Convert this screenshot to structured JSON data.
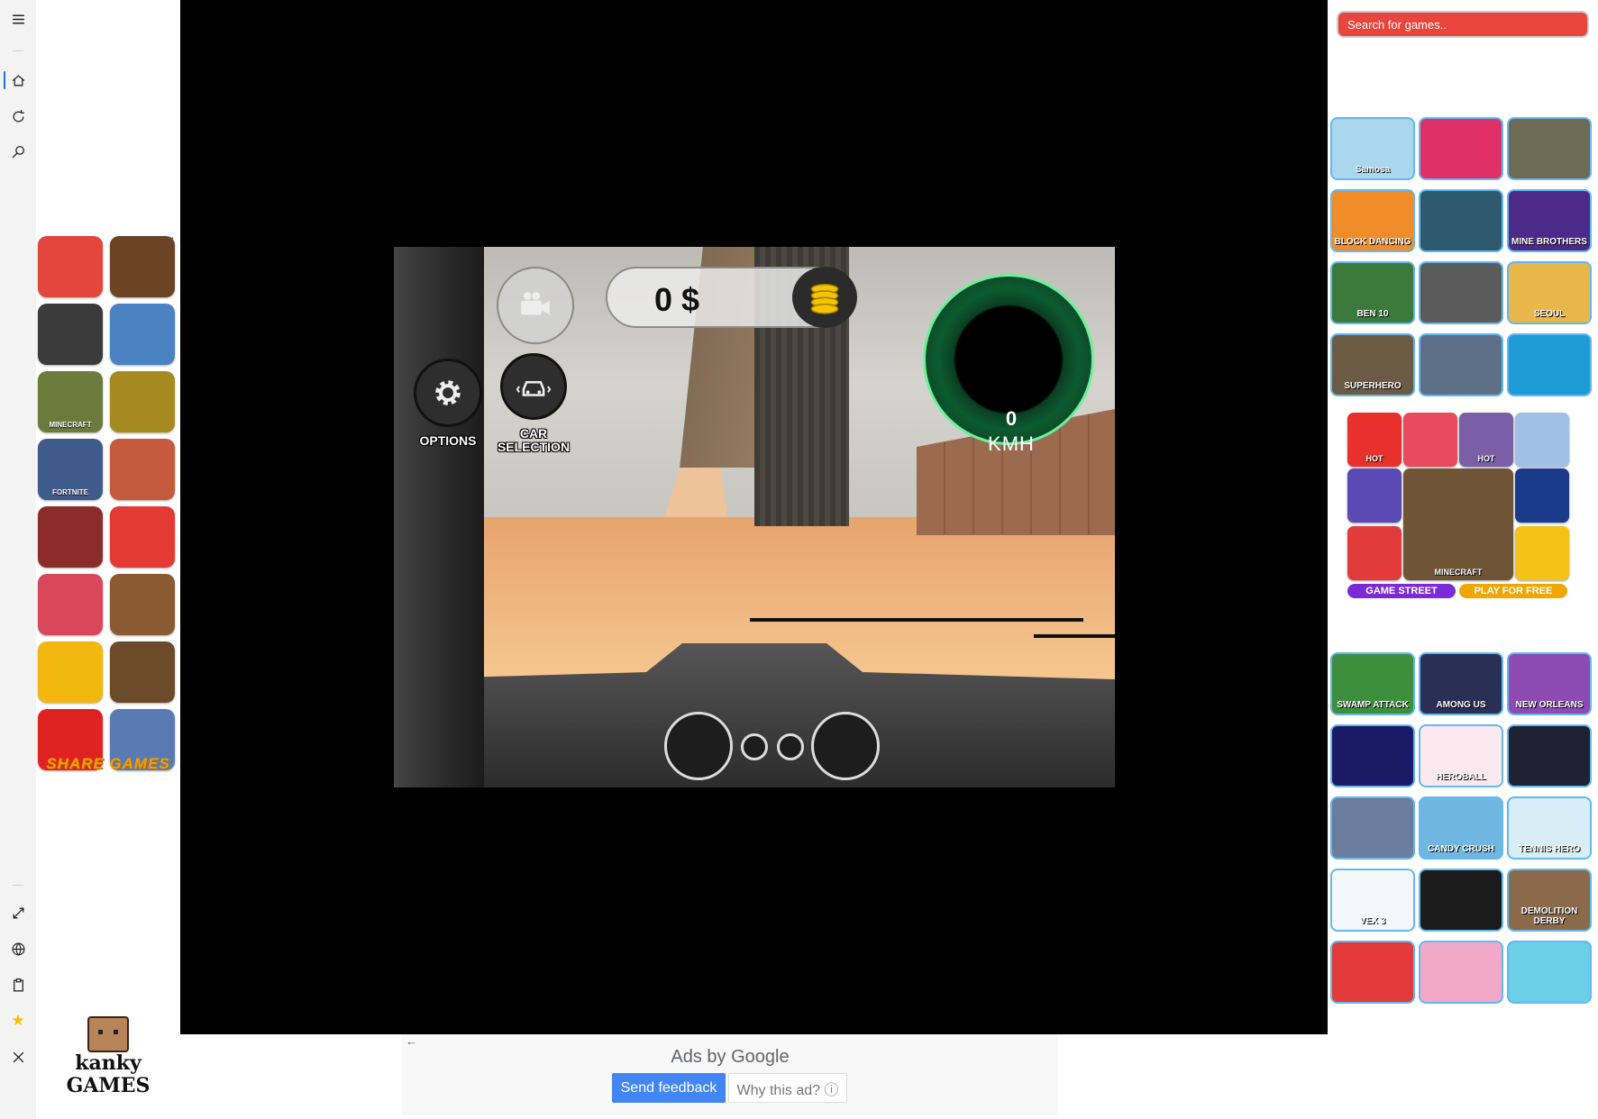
{
  "rail": {
    "top_icons": [
      "hamburger-icon",
      "home-icon",
      "refresh-icon",
      "search-icon"
    ],
    "bottom_icons": [
      "fullscreen-icon",
      "globe-icon",
      "clipboard-icon",
      "star-icon",
      "close-icon"
    ]
  },
  "left_ad": {
    "tiles": [
      {
        "label": "",
        "color": "#e2463c"
      },
      {
        "label": "",
        "color": "#6b4325"
      },
      {
        "label": "",
        "color": "#3b3b3b"
      },
      {
        "label": "",
        "color": "#4a82c2"
      },
      {
        "label": "MINECRAFT",
        "color": "#6c7a3b"
      },
      {
        "label": "",
        "color": "#a58a1f"
      },
      {
        "label": "FORTNITE",
        "color": "#3f5a8d"
      },
      {
        "label": "",
        "color": "#c65a3c"
      },
      {
        "label": "",
        "color": "#8a2d2a"
      },
      {
        "label": "",
        "color": "#e43a34"
      },
      {
        "label": "",
        "color": "#d9485a"
      },
      {
        "label": "",
        "color": "#8a5a33"
      },
      {
        "label": "",
        "color": "#f2b80f"
      },
      {
        "label": "",
        "color": "#6b4b2a"
      },
      {
        "label": "",
        "color": "#e02222"
      },
      {
        "label": "",
        "color": "#5a7ab3"
      }
    ],
    "footer": "SHARE GAMES"
  },
  "logo": {
    "line1": "kanky",
    "line2": "GAMES"
  },
  "game": {
    "money": "0 $",
    "options_label": "OPTIONS",
    "car_selection_label": "CAR SELECTION",
    "speed_value": "0",
    "speed_unit": "KMH"
  },
  "ads": {
    "ads_by": "Ads by",
    "google": "Google",
    "send_feedback": "Send feedback",
    "why_this_ad": "Why this ad? ⓘ"
  },
  "search": {
    "placeholder": "Search for games.."
  },
  "games_top": [
    {
      "title": "Samosa",
      "color": "#a8d7ee"
    },
    {
      "title": "",
      "color": "#e0306a"
    },
    {
      "title": "",
      "color": "#6e6a55"
    },
    {
      "title": "BLOCK DANCING",
      "color": "#f08c2a"
    },
    {
      "title": "",
      "color": "#2f5a6e"
    },
    {
      "title": "MINE BROTHERS",
      "color": "#4b2a8a"
    },
    {
      "title": "BEN 10",
      "color": "#3b7a3a"
    },
    {
      "title": "",
      "color": "#5b5b5b"
    },
    {
      "title": "SEOUL",
      "color": "#e9b64a"
    },
    {
      "title": "SUPERHERO",
      "color": "#6b5a44"
    },
    {
      "title": "",
      "color": "#5e6f88"
    },
    {
      "title": "",
      "color": "#1f9bd6"
    }
  ],
  "right_ad": {
    "tiles": [
      {
        "label": "HOT",
        "color": "#e8302c"
      },
      {
        "label": "",
        "color": "#e84a60"
      },
      {
        "label": "HOT",
        "color": "#7a5ea8"
      },
      {
        "label": "",
        "color": "#9fc1e8"
      },
      {
        "label": "",
        "color": "#5b4ab3"
      },
      {
        "label": "MINECRAFT",
        "color": "#6f5535"
      },
      {
        "label": "",
        "color": "#1b3b8a"
      },
      {
        "label": "",
        "color": "#e23b3b"
      },
      {
        "label": "",
        "color": "#f5c218"
      }
    ],
    "banner_left": "GAME STREET",
    "banner_right": "PLAY FOR FREE"
  },
  "games_bottom": [
    {
      "title": "SWAMP ATTACK",
      "color": "#3e8f3d"
    },
    {
      "title": "AMONG US",
      "color": "#2a2f55"
    },
    {
      "title": "NEW ORLEANS",
      "color": "#8e4ab3"
    },
    {
      "title": "",
      "color": "#1a1a66"
    },
    {
      "title": "HEROBALL",
      "color": "#fbe9ef"
    },
    {
      "title": "",
      "color": "#1e2233"
    },
    {
      "title": "",
      "color": "#6a7d9c"
    },
    {
      "title": "CANDY CRUSH",
      "color": "#6fb6e0"
    },
    {
      "title": "TENNIS HERO",
      "color": "#d7eef6"
    },
    {
      "title": "VEX 3",
      "color": "#f4f8fb"
    },
    {
      "title": "",
      "color": "#1b1b1b"
    },
    {
      "title": "DEMOLITION DERBY",
      "color": "#8a6a4a"
    },
    {
      "title": "",
      "color": "#e23a3a"
    },
    {
      "title": "",
      "color": "#f2a8c8"
    },
    {
      "title": "",
      "color": "#6ccfe8"
    }
  ]
}
